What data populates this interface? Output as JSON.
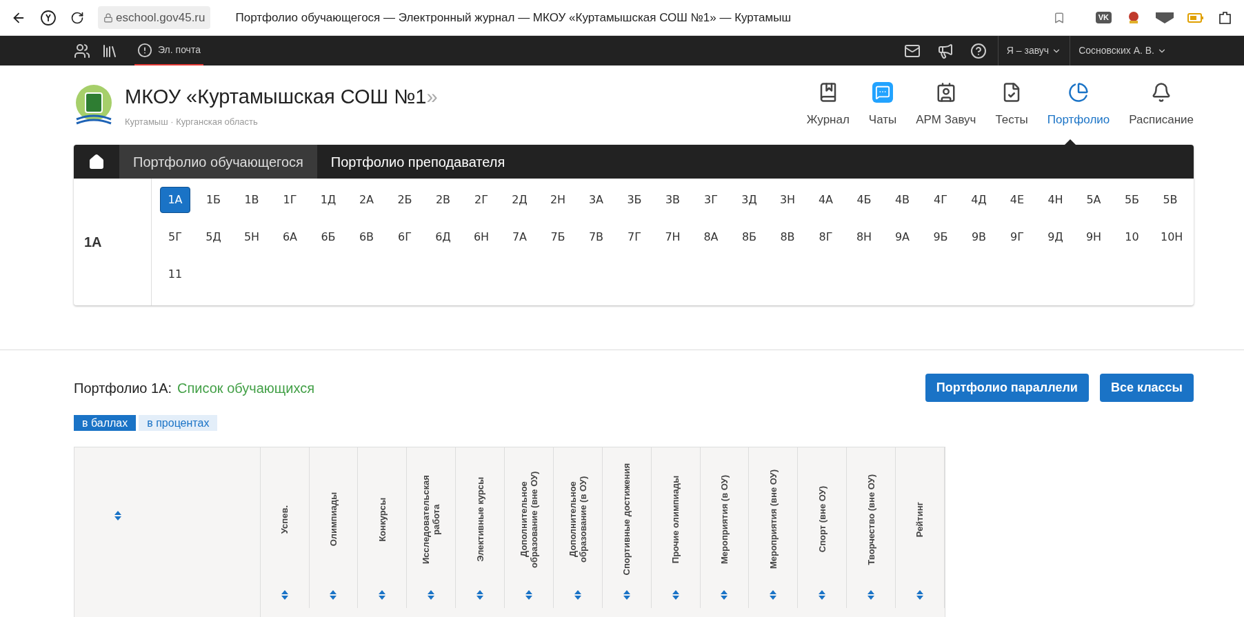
{
  "browser": {
    "address": "eschool.gov45.ru",
    "title": "Портфолио обучающегося — Электронный журнал — МКОУ «Куртамышская СОШ №1» — Куртамыш",
    "ext_label": "VK"
  },
  "topbar": {
    "mail": "Эл. почта",
    "role": "Я – завуч",
    "user": "Сосновских А. В."
  },
  "school": {
    "name": "МКОУ «Куртамышская СОШ №1",
    "name_end": "»",
    "place": "Куртамыш · Курганская область"
  },
  "nav": [
    {
      "kind": "journal",
      "label": "Журнал",
      "selected": false
    },
    {
      "kind": "chats",
      "label": "Чаты",
      "selected": false
    },
    {
      "kind": "arm",
      "label": "АРМ Завуч",
      "selected": false
    },
    {
      "kind": "tests",
      "label": "Тесты",
      "selected": false
    },
    {
      "kind": "portfolio",
      "label": "Портфолио",
      "selected": true
    },
    {
      "kind": "schedule",
      "label": "Расписание",
      "selected": false
    }
  ],
  "tabs": [
    {
      "label": "Портфолио обучающегося",
      "selected": true
    },
    {
      "label": "Портфолио преподавателя",
      "selected": false
    }
  ],
  "current_class": "1А",
  "classes": [
    {
      "label": "1А",
      "selected": true
    },
    {
      "label": "1Б",
      "selected": false
    },
    {
      "label": "1В",
      "selected": false
    },
    {
      "label": "1Г",
      "selected": false
    },
    {
      "label": "1Д",
      "selected": false
    },
    {
      "label": "2А",
      "selected": false
    },
    {
      "label": "2Б",
      "selected": false
    },
    {
      "label": "2В",
      "selected": false
    },
    {
      "label": "2Г",
      "selected": false
    },
    {
      "label": "2Д",
      "selected": false
    },
    {
      "label": "2Н",
      "selected": false
    },
    {
      "label": "3А",
      "selected": false
    },
    {
      "label": "3Б",
      "selected": false
    },
    {
      "label": "3В",
      "selected": false
    },
    {
      "label": "3Г",
      "selected": false
    },
    {
      "label": "3Д",
      "selected": false
    },
    {
      "label": "3Н",
      "selected": false
    },
    {
      "label": "4А",
      "selected": false
    },
    {
      "label": "4Б",
      "selected": false
    },
    {
      "label": "4В",
      "selected": false
    },
    {
      "label": "4Г",
      "selected": false
    },
    {
      "label": "4Д",
      "selected": false
    },
    {
      "label": "4Е",
      "selected": false
    },
    {
      "label": "4Н",
      "selected": false
    },
    {
      "label": "5А",
      "selected": false
    },
    {
      "label": "5Б",
      "selected": false
    },
    {
      "label": "5В",
      "selected": false
    },
    {
      "label": "5Г",
      "selected": false
    },
    {
      "label": "5Д",
      "selected": false
    },
    {
      "label": "5Н",
      "selected": false
    },
    {
      "label": "6А",
      "selected": false
    },
    {
      "label": "6Б",
      "selected": false
    },
    {
      "label": "6В",
      "selected": false
    },
    {
      "label": "6Г",
      "selected": false
    },
    {
      "label": "6Д",
      "selected": false
    },
    {
      "label": "6Н",
      "selected": false
    },
    {
      "label": "7А",
      "selected": false
    },
    {
      "label": "7Б",
      "selected": false
    },
    {
      "label": "7В",
      "selected": false
    },
    {
      "label": "7Г",
      "selected": false
    },
    {
      "label": "7Н",
      "selected": false
    },
    {
      "label": "8А",
      "selected": false
    },
    {
      "label": "8Б",
      "selected": false
    },
    {
      "label": "8В",
      "selected": false
    },
    {
      "label": "8Г",
      "selected": false
    },
    {
      "label": "8Н",
      "selected": false
    },
    {
      "label": "9А",
      "selected": false
    },
    {
      "label": "9Б",
      "selected": false
    },
    {
      "label": "9В",
      "selected": false
    },
    {
      "label": "9Г",
      "selected": false
    },
    {
      "label": "9Д",
      "selected": false
    },
    {
      "label": "9Н",
      "selected": false
    },
    {
      "label": "10",
      "selected": false
    },
    {
      "label": "10Н",
      "selected": false
    },
    {
      "label": "11",
      "selected": false
    }
  ],
  "section": {
    "title": "Портфолио 1А:",
    "subtitle": "Список обучающихся"
  },
  "buttons": [
    "Портфолио параллели",
    "Все классы"
  ],
  "modes": [
    {
      "label": "в баллах",
      "selected": true
    },
    {
      "label": "в процентах",
      "selected": false
    }
  ],
  "table": {
    "columns": [
      "Успев.",
      "Олимпиады",
      "Конкурсы",
      "Исследовательская работа",
      "Элективные курсы",
      "Дополнительное образование (вне ОУ)",
      "Дополнительное образование (в ОУ)",
      "Спортивные достижения",
      "Прочие олимпиады",
      "Мероприятия (в ОУ)",
      "Мероприятия (вне ОУ)",
      "Спорт (вне ОУ)",
      "Творчество (вне ОУ)",
      "Рейтинг"
    ]
  }
}
